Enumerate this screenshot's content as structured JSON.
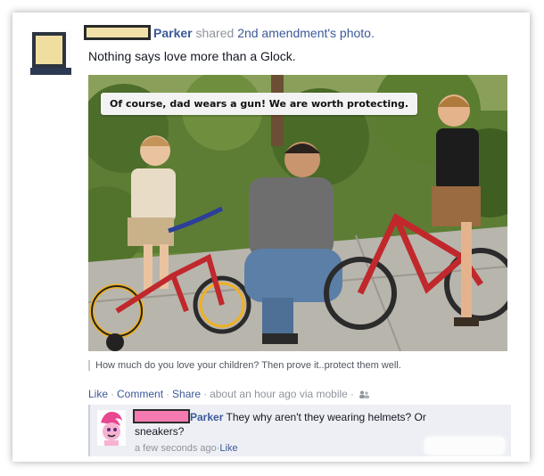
{
  "post": {
    "poster_name": "Parker",
    "shared_verb": "shared",
    "shared_source": "2nd amendment's photo.",
    "status_text": "Nothing says love more than a Glock."
  },
  "photo": {
    "speech_bubble": "Of course, dad wears a gun! We are worth protecting."
  },
  "caption": "How much do you love your children? Then prove it..protect them well.",
  "actions": {
    "like": "Like",
    "comment": "Comment",
    "share": "Share",
    "separator": "·",
    "time": "about an hour ago via mobile",
    "audience_icon": "friends-icon"
  },
  "comment": {
    "author": "Parker",
    "text": "They why aren't they wearing helmets? Or sneakers?",
    "time": "a few seconds ago",
    "like": "Like"
  }
}
